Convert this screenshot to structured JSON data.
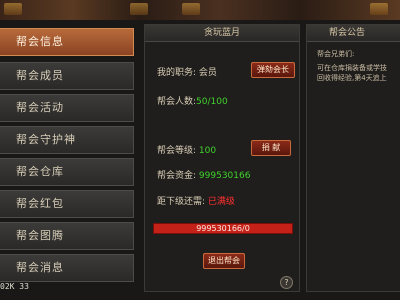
{
  "nav": {
    "items": [
      {
        "label": "帮会信息",
        "active": true
      },
      {
        "label": "帮会成员",
        "active": false
      },
      {
        "label": "帮会活动",
        "active": false
      },
      {
        "label": "帮会守护神",
        "active": false
      },
      {
        "label": "帮会仓库",
        "active": false
      },
      {
        "label": "帮会红包",
        "active": false
      },
      {
        "label": "帮会图腾",
        "active": false
      },
      {
        "label": "帮会消息",
        "active": false
      }
    ]
  },
  "info_panel": {
    "title": "贪玩蓝月",
    "position_label": "我的职务:",
    "position_value": "会员",
    "impeach_button": "弹劾会长",
    "members_label": "帮会人数:",
    "members_value": "50/100",
    "level_label": "帮会等级:",
    "level_value": "100",
    "donate_button": "捐 献",
    "funds_label": "帮会资金:",
    "funds_value": "999530166",
    "next_level_label": "距下级还需:",
    "next_level_value": "已满级",
    "progress_text": "999530166/0",
    "progress_fraction": 1.0,
    "quit_button": "退出帮会",
    "help_glyph": "?"
  },
  "notice_panel": {
    "title": "帮会公告",
    "lines": [
      "帮会兄弟们:",
      "可在仓库捐装备或学技",
      "回收得经验,第4天追上"
    ]
  },
  "status": {
    "text": "02K 33"
  },
  "colors": {
    "active_tab": "#b86a3a",
    "green_value": "#3ed32c",
    "red_value": "#ff3030",
    "button_red": "#8a2a18"
  }
}
